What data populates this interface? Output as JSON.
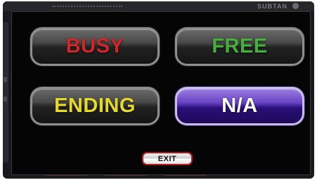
{
  "background": {
    "status_text": "SUBTAN"
  },
  "dialog": {
    "buttons": [
      {
        "label": "BUSY",
        "color": "#d0262a"
      },
      {
        "label": "FREE",
        "color": "#46b03c"
      },
      {
        "label": "ENDING",
        "color": "#e6d92c"
      },
      {
        "label": "N/A",
        "color": "#ffffff",
        "state": "selected"
      }
    ],
    "exit_label": "EXIT"
  },
  "colors": {
    "panel_background": "#050505",
    "selected_accent": "#6a43c4",
    "exit_border": "#b01c1c"
  }
}
